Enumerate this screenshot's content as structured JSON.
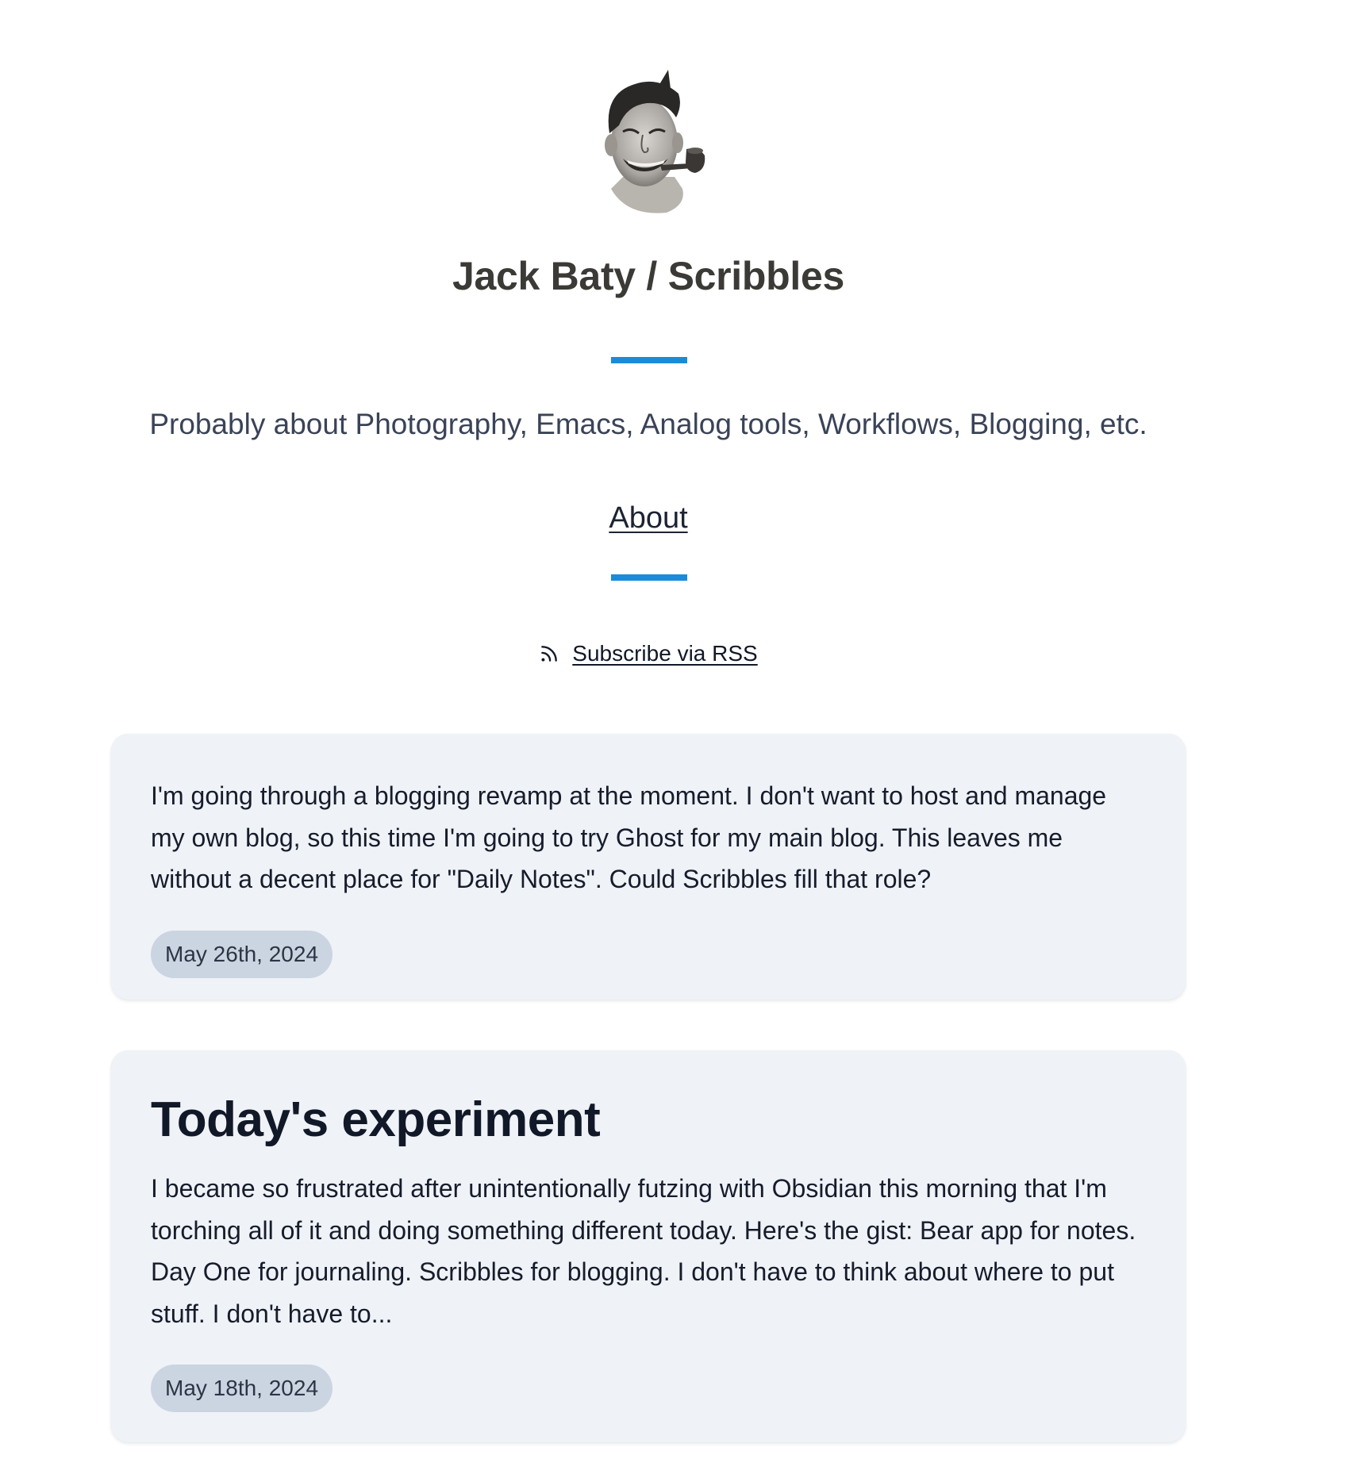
{
  "header": {
    "site_title": "Jack Baty / Scribbles",
    "tagline": "Probably about Photography, Emacs, Analog tools, Workflows, Blogging, etc.",
    "nav": [
      {
        "label": "About"
      }
    ],
    "rss": {
      "label": "Subscribe via RSS",
      "icon": "rss-icon"
    },
    "avatar": {
      "icon": "avatar-photo"
    },
    "accent_color": "#1a8bd8"
  },
  "posts": [
    {
      "title": "",
      "body": "I'm going through a blogging revamp at the moment. I don't want to host and manage my own blog, so this time I'm going to try Ghost for my main blog. This leaves me without a decent place for \"Daily Notes\". Could Scribbles fill that role?",
      "date": "May 26th, 2024"
    },
    {
      "title": "Today's experiment",
      "body": "I became so frustrated after unintentionally futzing with Obsidian this morning that I'm torching all of it and doing something different today. Here's the gist: Bear app for notes. Day One for journaling. Scribbles for blogging. I don't have to think about where to put stuff. I don't have to...",
      "date": "May 18th, 2024"
    }
  ]
}
